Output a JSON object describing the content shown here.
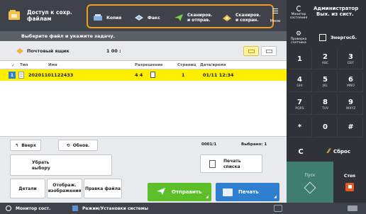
{
  "app": {
    "title_line1": "Доступ к сохр.",
    "title_line2": "файлам"
  },
  "shortcuts": [
    {
      "label": "Копия",
      "icon": "copy-icon"
    },
    {
      "label": "Факс",
      "icon": "fax-icon"
    },
    {
      "label_line1": "Сканиров.",
      "label_line2": "и отправ.",
      "icon": "scan-send-icon"
    },
    {
      "label_line1": "Сканиров.",
      "label_line2": "и сохран.",
      "icon": "scan-store-icon"
    }
  ],
  "menu": {
    "label": "Меню"
  },
  "user": {
    "line1": "Администратор",
    "line2": "Вых. из сист."
  },
  "status_monitor": {
    "label_line1": "Монитор",
    "label_line2": "состояния"
  },
  "energy": {
    "label": "Энергосб."
  },
  "counter": {
    "label_line1": "Проверка",
    "label_line2": "счетчика"
  },
  "hint": "Выберите файл и укажите задачу.",
  "mailbox": {
    "name": "Почтовый ящик",
    "number": "1 00 :"
  },
  "table": {
    "headers": [
      "Тип",
      "Имя",
      "Разрешение",
      "Страниц",
      "Дата/время"
    ],
    "rows": [
      {
        "num": "1",
        "name": "20201101122433",
        "resolution": "4 4",
        "pages": "1",
        "datetime": "01/11 12:34"
      }
    ]
  },
  "nav": {
    "up_label": "Вверх",
    "refresh_label": "Обнов.",
    "page": "0001/1",
    "selected": "Выбрано: 1"
  },
  "actions": {
    "clear_selection_line1": "Убрать",
    "clear_selection_line2": "выбору",
    "print_list_line1": "Печать",
    "print_list_line2": "списка",
    "details": "Детали",
    "preview_line1": "Отображ.",
    "preview_line2": "изображения",
    "edit_file": "Правка файла",
    "send": "Отправить",
    "print": "Печать"
  },
  "keypad": {
    "keys": [
      {
        "k": "1",
        "s": ""
      },
      {
        "k": "2",
        "s": "ABC"
      },
      {
        "k": "3",
        "s": "DEF"
      },
      {
        "k": "4",
        "s": "GHI"
      },
      {
        "k": "5",
        "s": "JKL"
      },
      {
        "k": "6",
        "s": "MNO"
      },
      {
        "k": "7",
        "s": "PQRS"
      },
      {
        "k": "8",
        "s": "TUV"
      },
      {
        "k": "9",
        "s": "WXYZ"
      },
      {
        "k": "*",
        "s": ""
      },
      {
        "k": "0",
        "s": ""
      },
      {
        "k": "#",
        "s": ""
      }
    ],
    "clear": "C",
    "reset": "Сброс",
    "start": "Пуск",
    "stop": "Стоп"
  },
  "bottom": {
    "status_monitor": "Монитор сост.",
    "remote": "Режим/Установки системы"
  },
  "colors": {
    "accent_orange": "#f39a1f",
    "selected_row": "#ffee00",
    "send_button": "#5cbf2a",
    "print_button": "#2f7fd0",
    "start_button": "#3f7e6e",
    "stop_button": "#2b2e33"
  }
}
